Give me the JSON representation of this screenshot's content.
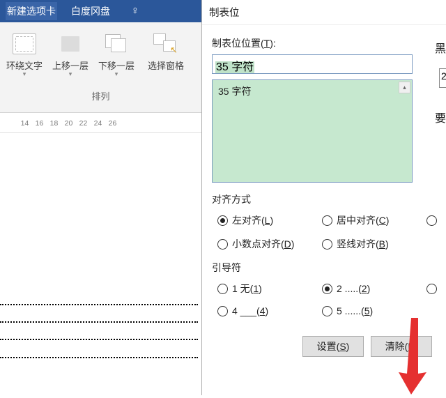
{
  "ribbon": {
    "tabs": [
      "新建选项卡",
      "白度冈盘"
    ],
    "buttons": {
      "wrap_text": "环绕文字",
      "bring_forward": "上移一层",
      "send_backward": "下移一层",
      "selection_pane": "选择窗格"
    },
    "group_label": "排列"
  },
  "ruler": {
    "ticks": [
      "",
      "14",
      "16",
      "18",
      "20",
      "22",
      "24",
      "26"
    ]
  },
  "dialog": {
    "title": "制表位",
    "position_label_pre": "制表位位置(",
    "position_label_key": "T",
    "position_label_post": "):",
    "input_value": "35 字符",
    "list_item": "35 字符",
    "right_edge_1": "黑",
    "right_edge_2": "2",
    "right_edge_3": "要",
    "align_section": "对齐方式",
    "align": {
      "left_pre": "左对齐(",
      "left_k": "L",
      "left_post": ")",
      "center_pre": "居中对齐(",
      "center_k": "C",
      "center_post": ")",
      "decimal_pre": "小数点对齐(",
      "decimal_k": "D",
      "decimal_post": ")",
      "bar_pre": "竖线对齐(",
      "bar_k": "B",
      "bar_post": ")"
    },
    "leader_section": "引导符",
    "leader": {
      "l1_pre": "1 无(",
      "l1_k": "1",
      "l1_post": ")",
      "l2_pre": "2 .....(",
      "l2_k": "2",
      "l2_post": ")",
      "l4_pre": "4 ___(",
      "l4_k": "4",
      "l4_post": ")",
      "l5_pre": "5 ......(",
      "l5_k": "5",
      "l5_post": ")"
    },
    "buttons": {
      "set_pre": "设置(",
      "set_k": "S",
      "set_post": ")",
      "clear_pre": "清除(",
      "clear_k": "E",
      "clear_post": ")"
    }
  }
}
